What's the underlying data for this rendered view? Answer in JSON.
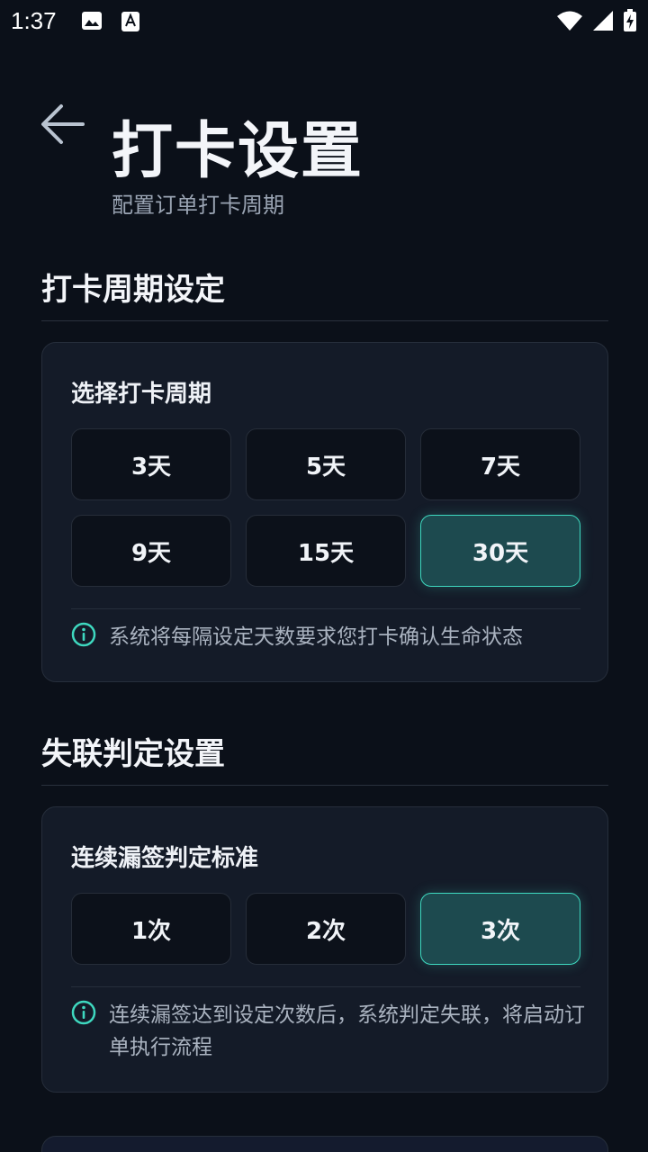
{
  "status_bar": {
    "time": "1:37",
    "icons": [
      "image-icon",
      "a-badge-icon",
      "wifi-icon",
      "signal-icon",
      "battery-charging-icon"
    ]
  },
  "header": {
    "back_icon": "arrow-left-icon",
    "title": "打卡设置",
    "subtitle": "配置订单打卡周期"
  },
  "period_section": {
    "title": "打卡周期设定",
    "card_title": "选择打卡周期",
    "options": [
      "3天",
      "5天",
      "7天",
      "9天",
      "15天",
      "30天"
    ],
    "selected": "30天",
    "info": "系统将每隔设定天数要求您打卡确认生命状态"
  },
  "lost_section": {
    "title": "失联判定设置",
    "card_title": "连续漏签判定标准",
    "options": [
      "1次",
      "2次",
      "3次"
    ],
    "selected": "3次",
    "info": "连续漏签达到设定次数后，系统判定失联，将启动订单执行流程"
  },
  "colors": {
    "background": "#0b1019",
    "card": "#141b28",
    "accent": "#3ed8bf",
    "selected_fill": "#1d4a4f"
  }
}
